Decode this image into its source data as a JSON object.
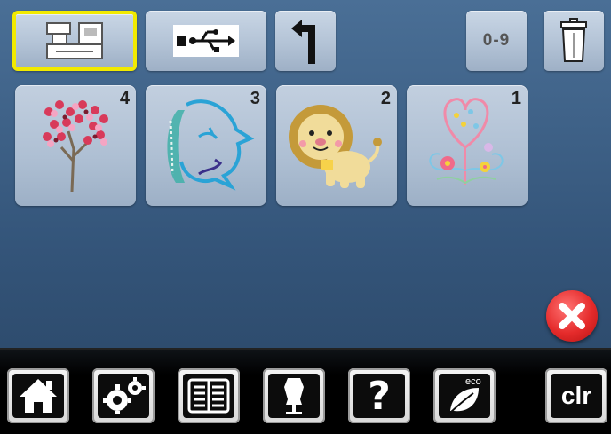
{
  "toolbar": {
    "machine_button": {
      "icon": "sewing-machine-icon",
      "state": "selected",
      "highlight_color": "#f2ea00"
    },
    "usb_button": {
      "icon": "usb-icon"
    },
    "back_button": {
      "icon": "return-arrow-icon"
    },
    "sort_button": {
      "label": "0-9"
    },
    "delete_button": {
      "icon": "trash-can-icon"
    }
  },
  "designs": [
    {
      "number": "4",
      "icon": "cherry-blossom-tree-design"
    },
    {
      "number": "3",
      "icon": "dolphin-outline-design"
    },
    {
      "number": "2",
      "icon": "lion-design"
    },
    {
      "number": "1",
      "icon": "heart-flowers-design"
    }
  ],
  "close_button": {
    "icon": "close-x-icon",
    "color": "#e52b2b"
  },
  "bottom_bar": {
    "items": [
      {
        "icon": "home-icon"
      },
      {
        "icon": "settings-gears-icon"
      },
      {
        "icon": "manual-book-icon"
      },
      {
        "icon": "dress-form-icon"
      },
      {
        "label": "?"
      },
      {
        "label": "eco",
        "icon": "leaf-icon"
      },
      {
        "label": "clr"
      }
    ]
  }
}
